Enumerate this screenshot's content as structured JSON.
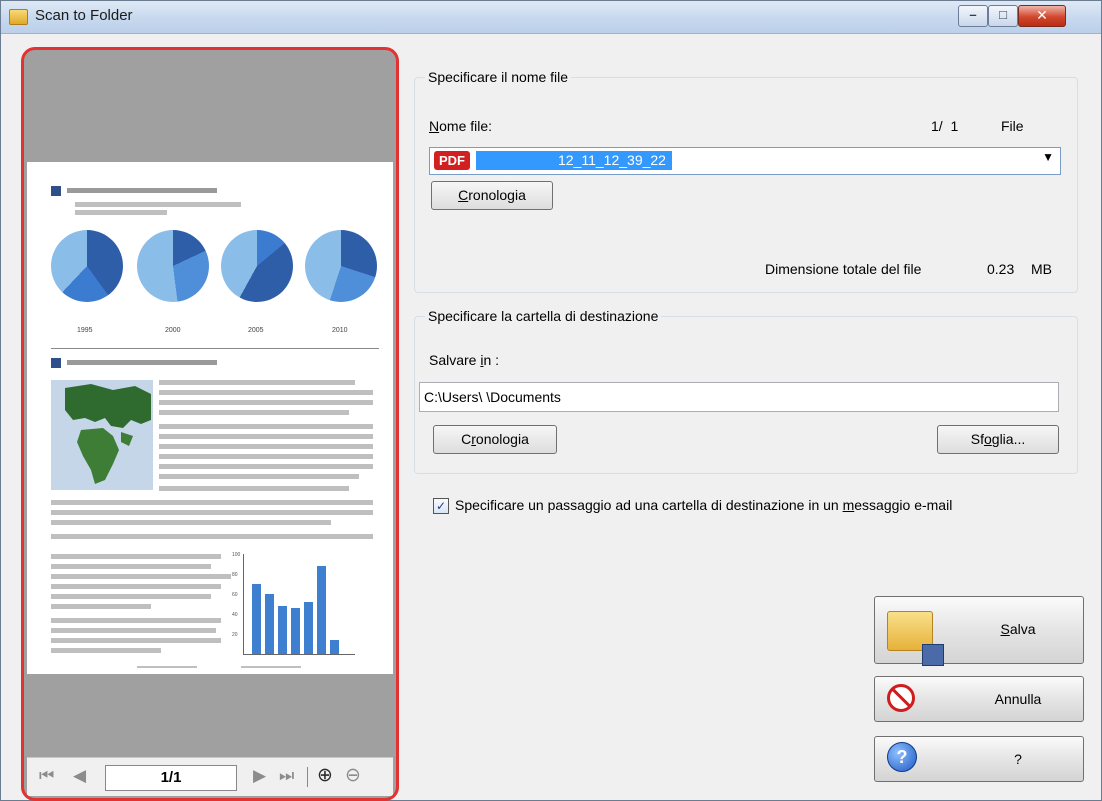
{
  "window": {
    "title": "Scan to Folder",
    "controls": {
      "minimize": "–",
      "maximize": "□",
      "close": "✕"
    }
  },
  "preview": {
    "years": [
      "1995",
      "2000",
      "2005",
      "2010"
    ],
    "chart_ticks": [
      "100",
      "80",
      "60",
      "40",
      "20"
    ],
    "navigation": {
      "page_indicator": "1/1",
      "first": "⏮",
      "previous": "◀",
      "next": "▶",
      "last": "⏭",
      "zoom_in": "⊕",
      "zoom_out": "⊖"
    }
  },
  "file_name_group": {
    "legend": "Specificare il nome file",
    "label_prefix": "N",
    "label_rest": "ome file:",
    "counter": "1/  1",
    "counter_unit": "File",
    "file_name": "12_11_12_39_22",
    "file_type_badge": "PDF",
    "history_prefix": "C",
    "history_rest": "ronologia",
    "total_size_label": "Dimensione totale del file",
    "total_size_value": "0.23",
    "total_size_unit": "MB"
  },
  "destination_group": {
    "legend": "Specificare la cartella di destinazione",
    "save_in_prefix": "Salvare ",
    "save_in_u": "i",
    "save_in_rest": "n :",
    "path": "C:\\Users\\     \\Documents",
    "history_prefix": "C",
    "history_u": "r",
    "history_rest": "onologia",
    "browse_prefix": "Sf",
    "browse_u": "o",
    "browse_rest": "glia..."
  },
  "email_option": {
    "checked": true,
    "check_mark": "✓",
    "label_prefix": "Specificare un passaggio ad una cartella di destinazione in un ",
    "label_u": "m",
    "label_rest": "essaggio e-mail"
  },
  "buttons": {
    "save_u": "S",
    "save_rest": "alva",
    "cancel": "Annulla",
    "help": "?",
    "help_icon": "?"
  }
}
